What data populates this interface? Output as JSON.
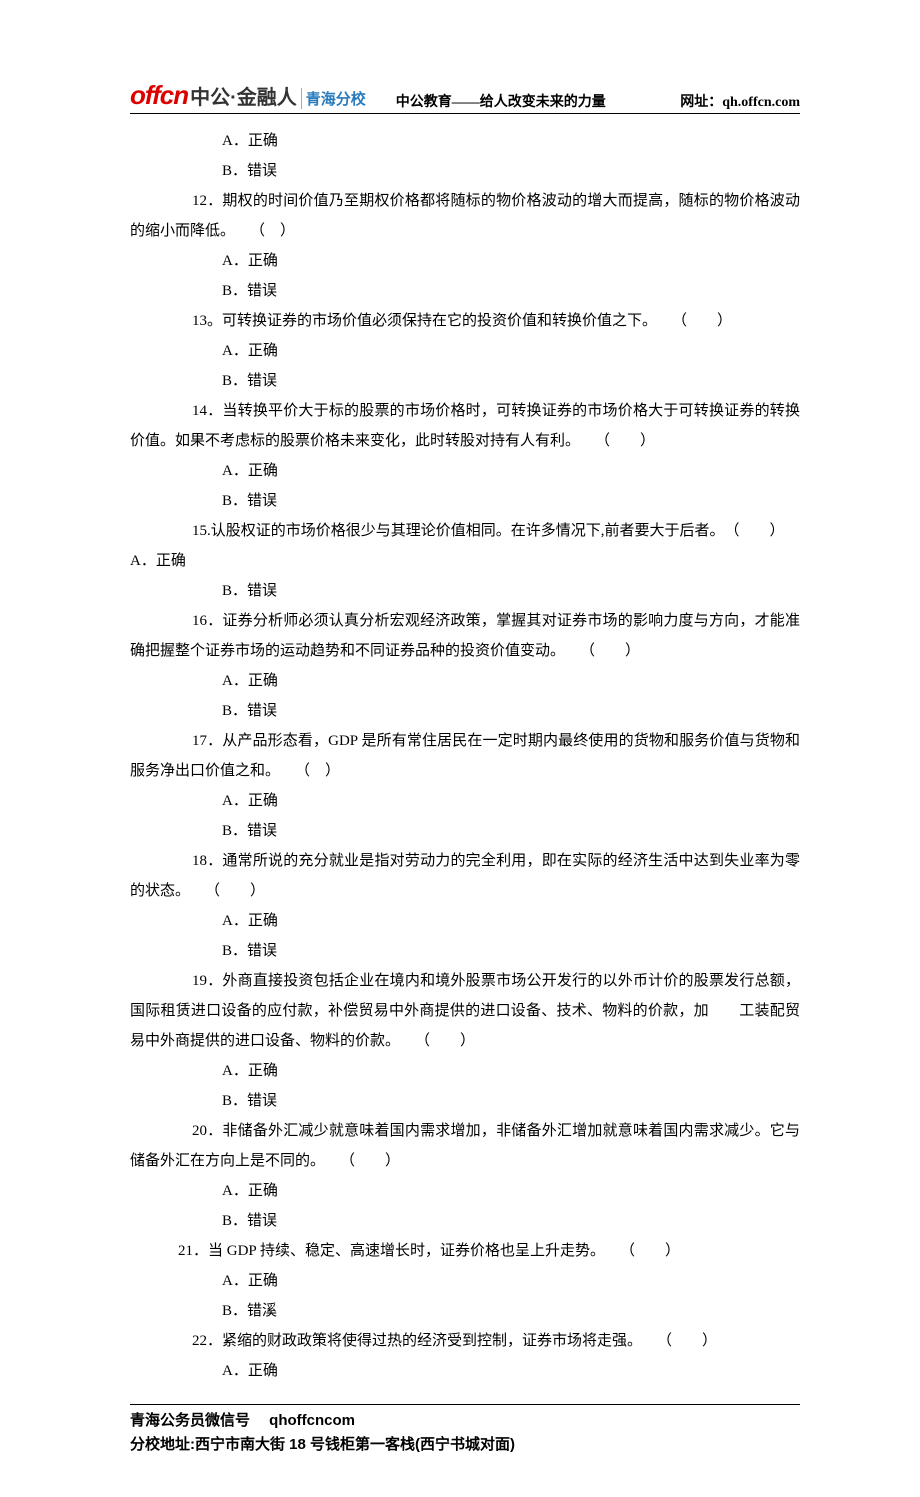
{
  "header": {
    "logo_offcn": "offcn",
    "logo_zg": "中公·金融人",
    "logo_qh": "青海分校",
    "slogan": "中公教育——给人改变未来的力量",
    "url_label": "网址：qh.offcn.com"
  },
  "options": {
    "A_correct": "A．正确",
    "B_wrong": "B．错误",
    "B_wrongxi": "B．错溪"
  },
  "q12": "12．期权的时间价值乃至期权价格都将随标的物价格波动的增大而提高，随标的物价格波动的缩小而降低。　　（　）",
  "q13": "13。可转换证券的市场价值必须保持在它的投资价值和转换价值之下。　　（　　）",
  "q14": "14．当转换平价大于标的股票的市场价格时，可转换证券的市场价格大于可转换证券的转换价值。如果不考虑标的股票价格未来变化，此时转股对持有人有利。　　（　　）",
  "q15a": "15.认股权证的市场价格很少与其理论价值相同。在许多情况下,前者要大于后者。　（　　）",
  "q15b": "A．正确",
  "q16": "16．证券分析师必须认真分析宏观经济政策，掌握其对证券市场的影响力度与方向，才能准确把握整个证券市场的运动趋势和不同证券品种的投资价值变动。　　（　　）",
  "q17": "17．从产品形态看，GDP 是所有常住居民在一定时期内最终使用的货物和服务价值与货物和服务净出口价值之和。　　（　）",
  "q18": "18．通常所说的充分就业是指对劳动力的完全利用，即在实际的经济生活中达到失业率为零的状态。　　（　　）",
  "q19": "19．外商直接投资包括企业在境内和境外股票市场公开发行的以外币计价的股票发行总额，国际租赁进口设备的应付款，补偿贸易中外商提供的进口设备、技术、物料的价款，加　　工装配贸易中外商提供的进口设备、物料的价款。　　（　　）",
  "q20": "20．非储备外汇减少就意味着国内需求增加，非储备外汇增加就意味着国内需求减少。它与储备外汇在方向上是不同的。　　（　　）",
  "q21": "21．当 GDP 持续、稳定、高速增长时，证券价格也呈上升走势。　　（　　）",
  "q22": "22．紧缩的财政政策将使得过热的经济受到控制，证券市场将走强。　　（　　）",
  "footer": {
    "line1": "青海公务员微信号　 qhoffcncom",
    "line2": "分校地址:西宁市南大街 18 号钱柜第一客栈(西宁书城对面)"
  }
}
